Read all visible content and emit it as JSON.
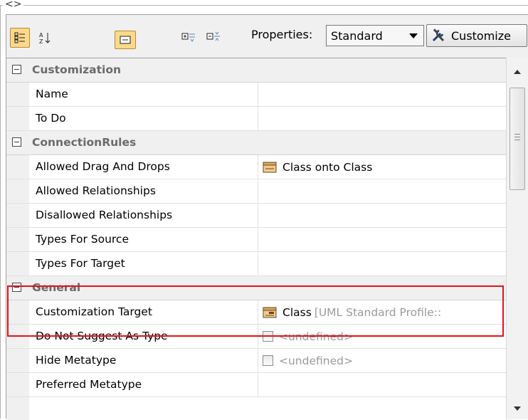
{
  "window": {
    "title": "<>"
  },
  "toolbar": {
    "properties_label": "Properties:",
    "properties_select": "Standard",
    "customize_label": "Customize",
    "buttons": [
      {
        "icon": "categorized-view-icon",
        "toggled": true
      },
      {
        "icon": "sort-alphabetical-icon",
        "toggled": false
      },
      {
        "icon": "show-description-icon",
        "toggled": true
      },
      {
        "icon": "expand-all-icon",
        "toggled": false
      },
      {
        "icon": "collapse-all-icon",
        "toggled": false
      }
    ]
  },
  "categories": {
    "customization": "Customization",
    "connection_rules": "ConnectionRules",
    "general": "General"
  },
  "rows": {
    "name": {
      "label": "Name",
      "value": ""
    },
    "to_do": {
      "label": "To Do",
      "value": ""
    },
    "allowed_drag_and_drops": {
      "label": "Allowed Drag And Drops",
      "value": "Class onto Class"
    },
    "allowed_relationships": {
      "label": "Allowed Relationships",
      "value": ""
    },
    "disallowed_relationships": {
      "label": "Disallowed Relationships",
      "value": ""
    },
    "types_for_source": {
      "label": "Types For Source",
      "value": ""
    },
    "types_for_target": {
      "label": "Types For Target",
      "value": ""
    },
    "customization_target": {
      "label": "Customization Target",
      "value": "Class",
      "qualifier": "[UML Standard Profile::"
    },
    "do_not_suggest_as_type": {
      "label": "Do Not Suggest As Type",
      "value": "<undefined>"
    },
    "hide_metatype": {
      "label": "Hide Metatype",
      "value": "<undefined>"
    },
    "preferred_metatype": {
      "label": "Preferred Metatype",
      "value": ""
    }
  },
  "colors": {
    "highlight": "#e4111b",
    "toggled": "#fcd88a",
    "category_text": "#6b6b6b"
  }
}
